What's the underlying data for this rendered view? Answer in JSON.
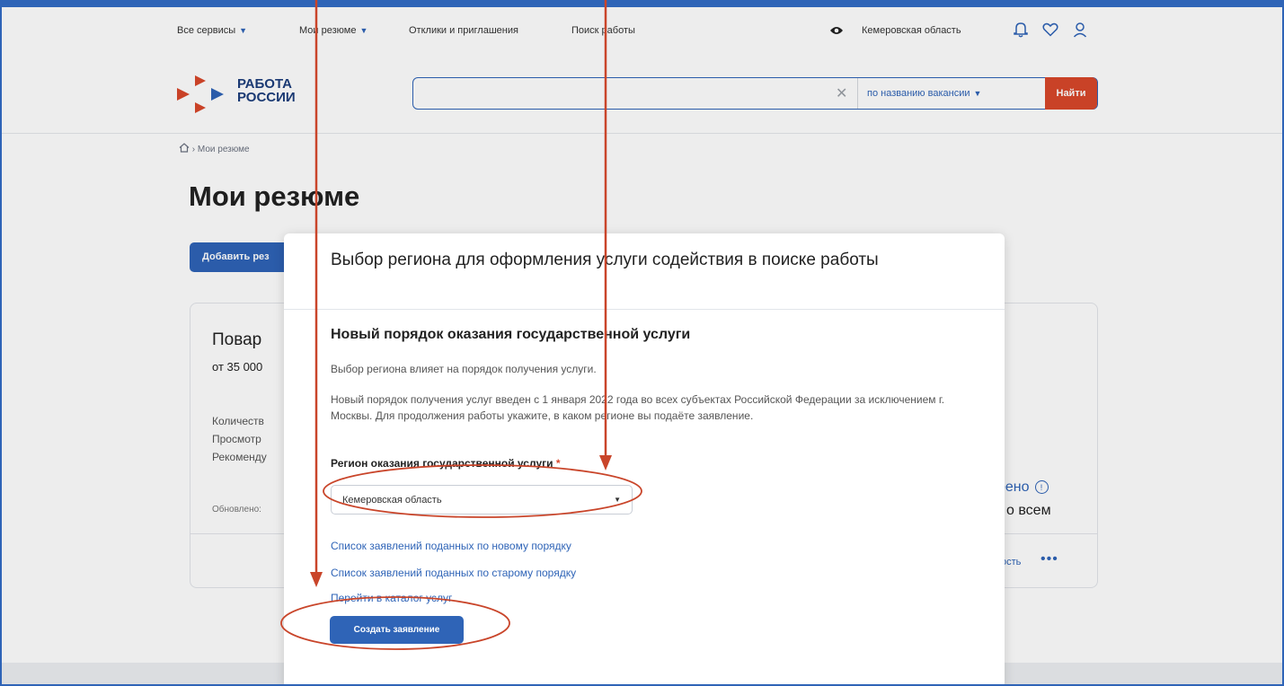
{
  "topnav": {
    "all_services": "Все сервисы",
    "my_resumes": "Мои резюме",
    "responses": "Отклики и приглашения",
    "job_search": "Поиск работы",
    "region": "Кемеровская область"
  },
  "logo": {
    "line1": "РАБОТА",
    "line2": "РОССИИ"
  },
  "search": {
    "value": "",
    "mode": "по названию вакансии",
    "button": "Найти"
  },
  "breadcrumb": {
    "current": "Мои резюме"
  },
  "page": {
    "title": "Мои резюме",
    "add_button": "Добавить рез"
  },
  "card": {
    "title": "Повар",
    "salary": "от 35 000",
    "line1": "Количеств",
    "line2": "Просмотр",
    "line3": "Рекоменду",
    "updated": "Обновлено:",
    "status": "рено",
    "status2": "о всем",
    "action": "ость",
    "more": "•••"
  },
  "modal": {
    "title": "Выбор региона для оформления услуги содействия в поиске работы",
    "subtitle": "Новый порядок оказания государственной услуги",
    "text1": "Выбор региона влияет на порядок получения услуги.",
    "text2": "Новый порядок получения услуг введен с 1 января 2022 года во всех субъектах Российской Федерации за исключением г. Москвы. Для продолжения работы укажите, в каком регионе вы подаёте заявление.",
    "field_label": "Регион оказания государственной услуги",
    "required_mark": "*",
    "selected_region": "Кемеровская область",
    "link_new": "Список заявлений поданных по новому порядку",
    "link_old": "Список заявлений поданных по старому порядку",
    "link_catalog": "Перейти в каталог услуг",
    "create_button": "Создать заявление"
  },
  "colors": {
    "primary": "#2f64b7",
    "accent": "#d9472b",
    "annotation": "#c9452a"
  },
  "icons": {
    "visibility": "eye-icon",
    "notifications": "bell-icon",
    "favorites": "heart-icon",
    "profile": "user-icon",
    "home": "home-icon",
    "clear": "close-icon",
    "dropdown": "caret-down-icon",
    "info": "info-icon"
  }
}
